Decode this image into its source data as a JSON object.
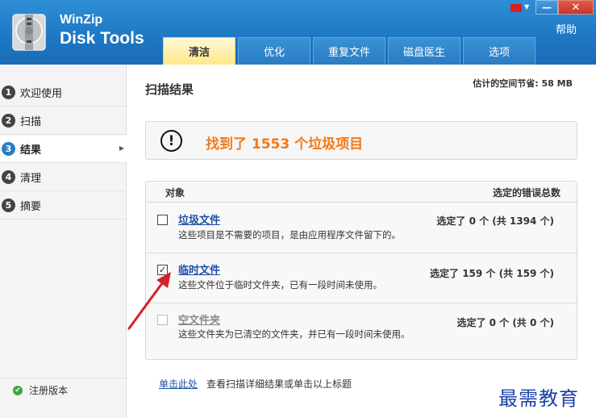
{
  "app": {
    "brand_line1": "WinZip",
    "brand_line2": "Disk Tools"
  },
  "title_bar": {
    "help": "帮助",
    "minimize": "—",
    "close": "✕"
  },
  "tabs": [
    {
      "label": "清洁",
      "active": true
    },
    {
      "label": "优化",
      "active": false
    },
    {
      "label": "重复文件",
      "active": false
    },
    {
      "label": "磁盘医生",
      "active": false
    },
    {
      "label": "选项",
      "active": false
    }
  ],
  "sidebar": {
    "items": [
      {
        "num": "1",
        "label": "欢迎使用"
      },
      {
        "num": "2",
        "label": "扫描"
      },
      {
        "num": "3",
        "label": "结果",
        "active": true
      },
      {
        "num": "4",
        "label": "清理"
      },
      {
        "num": "5",
        "label": "摘要"
      }
    ],
    "register_label": "注册版本"
  },
  "main": {
    "title": "扫描结果",
    "savings": "估计的空间节省: 58 MB",
    "summary": "找到了 1553 个垃圾项目",
    "columns": {
      "object": "对象",
      "errors": "选定的错误总数"
    },
    "items": [
      {
        "title": "垃圾文件",
        "desc": "这些项目是不需要的项目，是由应用程序文件留下的。",
        "count": "选定了 0 个 (共 1394 个)",
        "checked": false,
        "disabled": false
      },
      {
        "title": "临时文件",
        "desc": "这些文件位于临时文件夹，已有一段时间未使用。",
        "count": "选定了 159 个 (共 159 个)",
        "checked": true,
        "disabled": false
      },
      {
        "title": "空文件夹",
        "desc": "这些文件夹为已清空的文件夹，并已有一段时间未使用。",
        "count": "选定了 0 个 (共 0 个)",
        "checked": false,
        "disabled": true
      }
    ],
    "footer_link": "单击此处",
    "footer_text": "查看扫描详细结果或单击以上标题"
  },
  "watermark": "最需教育",
  "colors": {
    "header_blue": "#1f78c4",
    "accent_orange": "#f07a1a",
    "link_blue": "#1e4fa6",
    "annotation_red": "#d8202a"
  }
}
